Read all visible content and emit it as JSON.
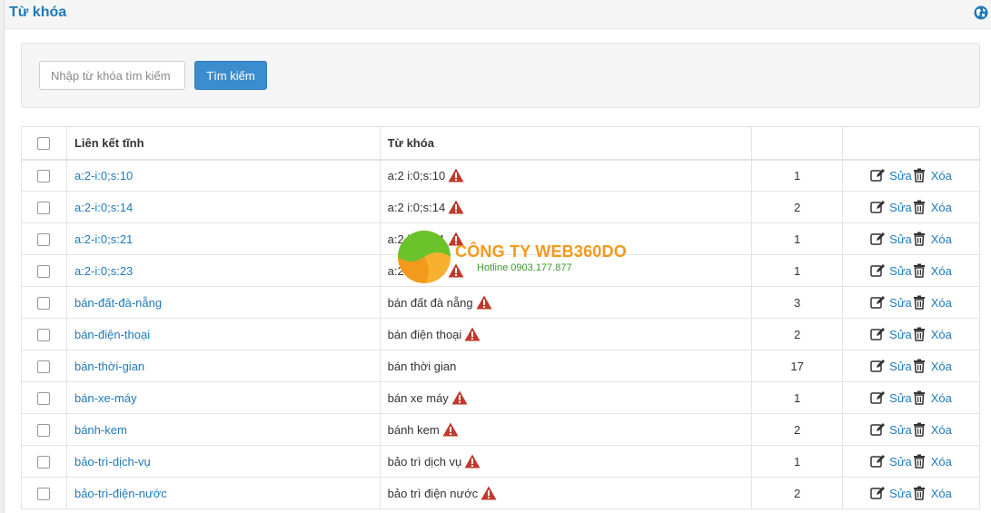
{
  "header": {
    "title": "Từ khóa",
    "help_icon": "globe-icon"
  },
  "search": {
    "placeholder": "Nhập từ khóa tìm kiếm",
    "value": "",
    "button_label": "Tìm kiếm"
  },
  "table": {
    "columns": {
      "link": "Liên kết tĩnh",
      "keyword": "Từ khóa",
      "count": "",
      "actions": ""
    },
    "rows": [
      {
        "link": "a:2-i:0;s:10",
        "keyword": "a:2 i:0;s:10",
        "warn": true,
        "count": "1"
      },
      {
        "link": "a:2-i:0;s:14",
        "keyword": "a:2 i:0;s:14",
        "warn": true,
        "count": "2"
      },
      {
        "link": "a:2-i:0;s:21",
        "keyword": "a:2 i:0;s:21",
        "warn": true,
        "count": "1"
      },
      {
        "link": "a:2-i:0;s:23",
        "keyword": "a:2 i:0;s:23",
        "warn": true,
        "count": "1"
      },
      {
        "link": "bán-đất-đà-nẵng",
        "keyword": "bán đất đà nẵng",
        "warn": true,
        "count": "3"
      },
      {
        "link": "bán-điện-thoại",
        "keyword": "bán điện thoại",
        "warn": true,
        "count": "2"
      },
      {
        "link": "bán-thời-gian",
        "keyword": "bán thời gian",
        "warn": false,
        "count": "17"
      },
      {
        "link": "bán-xe-máy",
        "keyword": "bán xe máy",
        "warn": true,
        "count": "1"
      },
      {
        "link": "bánh-kem",
        "keyword": "bánh kem",
        "warn": true,
        "count": "2"
      },
      {
        "link": "bảo-trì-dịch-vụ",
        "keyword": "bảo trì dịch vụ",
        "warn": true,
        "count": "1"
      },
      {
        "link": "bảo-trì-điện-nước",
        "keyword": "bảo trì điện nước",
        "warn": true,
        "count": "2"
      }
    ],
    "edit_label": "Sửa",
    "delete_label": "Xóa"
  },
  "watermark": {
    "name": "CÔNG TY WEB360DO",
    "hotline": "Hotline 0903.177.877"
  },
  "colors": {
    "accent": "#1f7ab8",
    "button": "#3c8dce",
    "warning": "#c0392b"
  }
}
